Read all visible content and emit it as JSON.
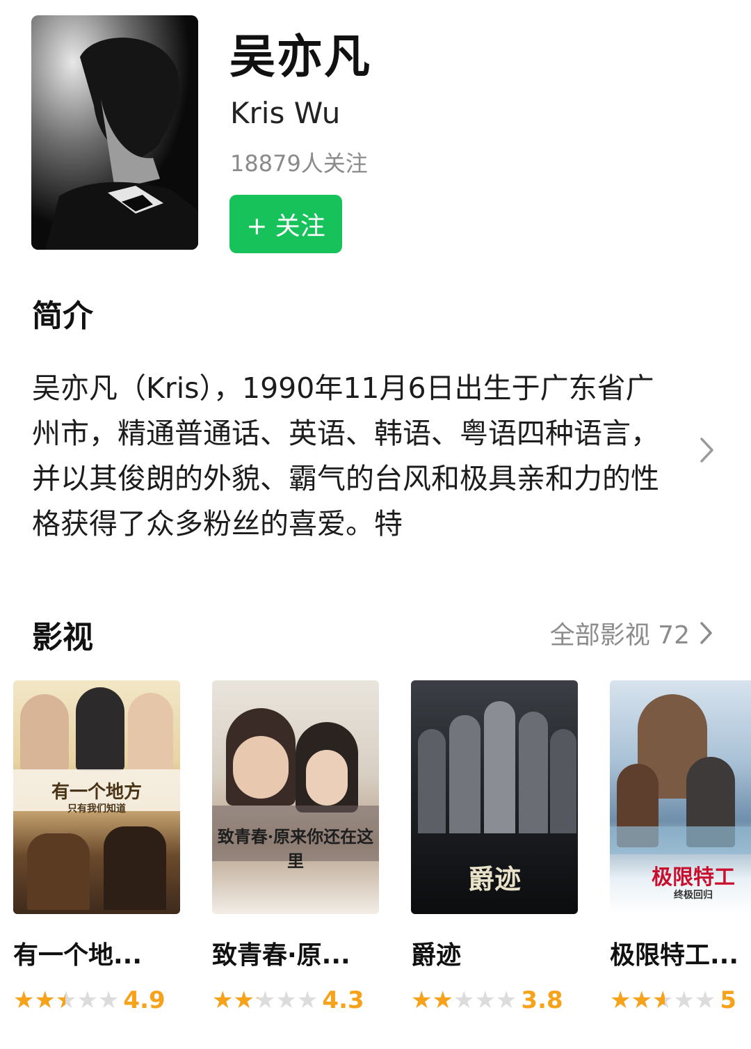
{
  "profile": {
    "name_cn": "吴亦凡",
    "name_en": "Kris Wu",
    "followers": "18879人关注",
    "follow_button": "+ 关注"
  },
  "intro": {
    "title": "简介",
    "text": "吴亦凡（Kris），1990年11月6日出生于广东省广州市，精通普通话、英语、韩语、粤语四种语言，并以其俊朗的外貌、霸气的台风和极具亲和力的性格获得了众多粉丝的喜爱。特"
  },
  "films": {
    "title": "影视",
    "all_label": "全部影视 72",
    "items": [
      {
        "name": "有一个地...",
        "score": "4.9",
        "rating": 0.49,
        "poster_text": "有一个地方",
        "poster_sub": "只有我们知道"
      },
      {
        "name": "致青春·原...",
        "score": "4.3",
        "rating": 0.43,
        "poster_text": "致青春·原来你还在这里",
        "poster_sub": ""
      },
      {
        "name": "爵迹",
        "score": "3.8",
        "rating": 0.38,
        "poster_text": "爵迹",
        "poster_sub": ""
      },
      {
        "name": "极限特工...",
        "score": "5",
        "rating": 0.52,
        "poster_text": "极限特工",
        "poster_sub": "终极回归"
      }
    ]
  },
  "icons": {
    "chevron": "chevron-right-icon",
    "star": "star-icon"
  },
  "colors": {
    "follow_button": "#18c25a",
    "star": "#f7a21b"
  }
}
